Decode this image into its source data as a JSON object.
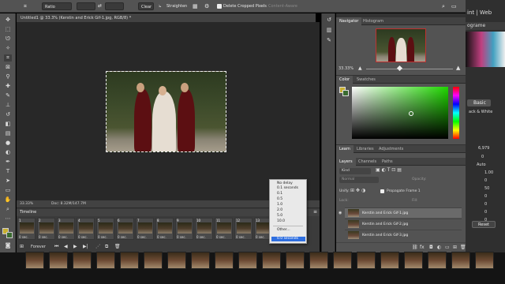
{
  "options_bar": {
    "ratio_label": "Ratio",
    "clear_label": "Clear",
    "straighten_label": "Straighten",
    "delete_cropped_label": "Delete Cropped Pixels",
    "content_aware_label": "Content-Aware"
  },
  "document": {
    "tab_title": "Untitled1 @ 33.3% (Kerstin and Erick Gif-1.jpg, RGB/8) *",
    "zoom": "33.33%",
    "doc_size": "Doc: 8.32M/147.7M"
  },
  "timeline": {
    "title": "Timeline",
    "frames": [
      {
        "num": "1",
        "dur": "0 sec."
      },
      {
        "num": "2",
        "dur": "0 sec."
      },
      {
        "num": "3",
        "dur": "0 sec."
      },
      {
        "num": "4",
        "dur": "0 sec."
      },
      {
        "num": "5",
        "dur": "0 sec."
      },
      {
        "num": "6",
        "dur": "0 sec."
      },
      {
        "num": "7",
        "dur": "0 sec."
      },
      {
        "num": "8",
        "dur": "0 sec."
      },
      {
        "num": "9",
        "dur": "0 sec."
      },
      {
        "num": "10",
        "dur": "0 sec."
      },
      {
        "num": "11",
        "dur": "0 sec."
      },
      {
        "num": "12",
        "dur": "0 sec."
      },
      {
        "num": "13",
        "dur": "0 sec."
      }
    ],
    "loop": "Forever"
  },
  "delay_menu": {
    "items": [
      "No delay",
      "0.1 seconds",
      "0.1",
      "0.5",
      "1.0",
      "2.0",
      "5.0",
      "10.0"
    ],
    "other": "Other...",
    "selected": "0.0 seconds"
  },
  "navigator": {
    "tabs": [
      "Navigator",
      "Histogram"
    ],
    "zoom": "33.33%"
  },
  "color_panel": {
    "tabs": [
      "Color",
      "Swatches"
    ]
  },
  "learn_panel": {
    "tabs": [
      "Learn",
      "Libraries",
      "Adjustments"
    ]
  },
  "layers_panel": {
    "tabs": [
      "Layers",
      "Channels",
      "Paths"
    ],
    "kind_label": "Kind",
    "mode_label": "Normal",
    "opacity_label": "Opacity:",
    "unify_label": "Unify:",
    "propagate_label": "Propagate Frame 1",
    "lock_label": "Lock:",
    "fill_label": "Fill:",
    "layers": [
      "Kerstin and Erick Gif-1.jpg",
      "Kerstin and Erick Gif-2.jpg",
      "Kerstin and Erick Gif-3.jpg"
    ]
  },
  "far_right": {
    "menu_text": "int | Web",
    "panel_title": "ograme",
    "basic_tab": "Basic",
    "bw_label": "ack & White",
    "value1": "6,979",
    "value2": "0",
    "auto_label": "Auto",
    "vals": [
      "1.00",
      "0",
      "50",
      "0",
      "0",
      "0",
      "0"
    ],
    "reset_label": "Reset"
  },
  "colors": {
    "selection_blue": "#2f6fe0",
    "panel_bg": "#535353",
    "canvas_bg": "#282828"
  }
}
